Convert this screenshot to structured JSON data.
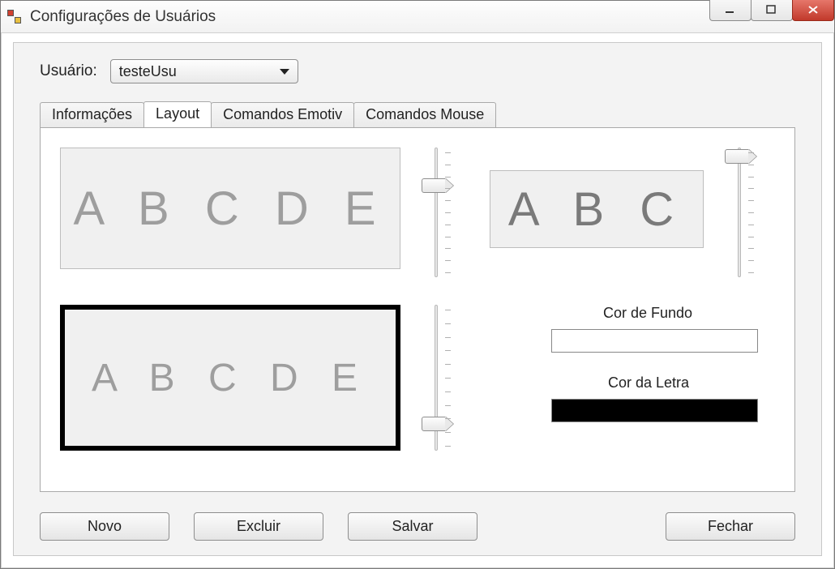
{
  "window": {
    "title": "Configurações de Usuários"
  },
  "user": {
    "label": "Usuário:",
    "selected": "testeUsu"
  },
  "tabs": {
    "items": [
      {
        "label": "Informações"
      },
      {
        "label": "Layout"
      },
      {
        "label": "Comandos Emotiv"
      },
      {
        "label": "Comandos Mouse"
      }
    ],
    "active_index": 1
  },
  "layout_tab": {
    "preview1_text": "A B C D E",
    "preview2_text": "A B C",
    "preview3_text": "A B C D E",
    "bg_color_label": "Cor de Fundo",
    "fg_color_label": "Cor da Letra",
    "bg_color": "#ffffff",
    "fg_color": "#000000"
  },
  "buttons": {
    "novo": "Novo",
    "excluir": "Excluir",
    "salvar": "Salvar",
    "fechar": "Fechar"
  }
}
